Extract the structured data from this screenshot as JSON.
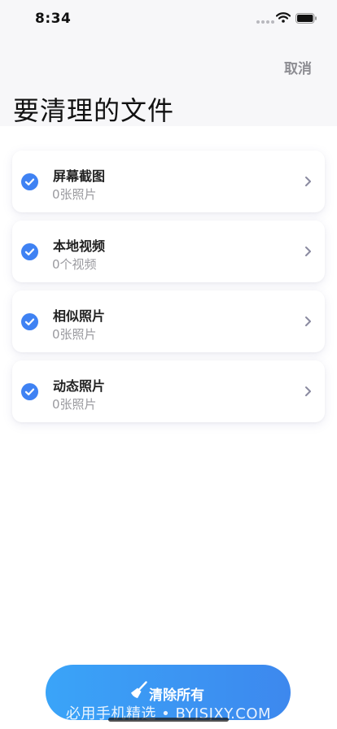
{
  "status_bar": {
    "time": "8:34"
  },
  "header": {
    "cancel_label": "取消",
    "title": "要清理的文件"
  },
  "accent_color": "#3f82f3",
  "items": [
    {
      "name": "屏幕截图",
      "count": "0张照片",
      "checked": true
    },
    {
      "name": "本地视频",
      "count": "0个视频",
      "checked": true
    },
    {
      "name": "相似照片",
      "count": "0张照片",
      "checked": true
    },
    {
      "name": "动态照片",
      "count": "0张照片",
      "checked": true
    }
  ],
  "footer": {
    "clean_button_label": "清除所有",
    "watermark": "必用手机精选 • BYJSJXY.COM"
  }
}
